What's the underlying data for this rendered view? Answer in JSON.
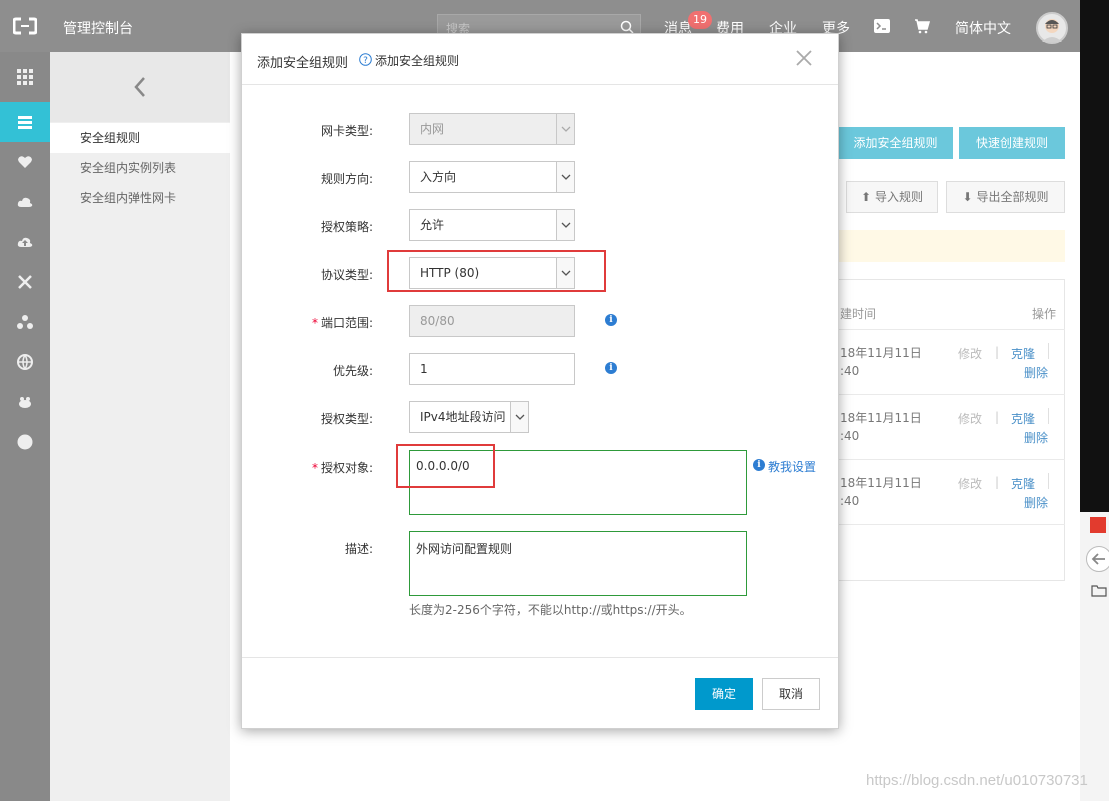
{
  "topbar": {
    "logo_icon": "aliyun-logo-icon",
    "title": "管理控制台",
    "search_placeholder": "搜索",
    "nav": {
      "messages": "消息",
      "messages_badge": "19",
      "fees": "费用",
      "enterprise": "企业",
      "more": "更多",
      "language": "简体中文"
    }
  },
  "subnav": {
    "items": [
      {
        "label": "安全组规则",
        "active": true
      },
      {
        "label": "安全组内实例列表",
        "active": false
      },
      {
        "label": "安全组内弹性网卡",
        "active": false
      }
    ]
  },
  "background_page": {
    "add_rule_button": "添加安全组规则",
    "quick_create_button": "快速创建规则",
    "import_button": "导入规则",
    "export_button": "导出全部规则",
    "col_time": "建时间",
    "col_action": "操作",
    "rows": [
      {
        "date": "18年11月11日",
        "time": ":40",
        "edit": "修改",
        "clone": "克隆",
        "delete": "删除"
      },
      {
        "date": "18年11月11日",
        "time": ":40",
        "edit": "修改",
        "clone": "克隆",
        "delete": "删除"
      },
      {
        "date": "18年11月11日",
        "time": ":40",
        "edit": "修改",
        "clone": "克隆",
        "delete": "删除"
      }
    ]
  },
  "dialog": {
    "title": "添加安全组规则",
    "subtitle": "添加安全组规则",
    "fields": {
      "nic_type": {
        "label": "网卡类型:",
        "value": "内网"
      },
      "direction": {
        "label": "规则方向:",
        "value": "入方向"
      },
      "policy": {
        "label": "授权策略:",
        "value": "允许"
      },
      "protocol": {
        "label": "协议类型:",
        "value": "HTTP (80)"
      },
      "port_range": {
        "label": "端口范围:",
        "value": "80/80"
      },
      "priority": {
        "label": "优先级:",
        "value": "1"
      },
      "auth_type": {
        "label": "授权类型:",
        "value": "IPv4地址段访问"
      },
      "auth_object": {
        "label": "授权对象:",
        "value": "0.0.0.0/0"
      },
      "description": {
        "label": "描述:",
        "value": "外网访问配置规则"
      }
    },
    "teach_link": "教我设置",
    "description_hint": "长度为2-256个字符，不能以http://或https://开头。",
    "ok_button": "确定",
    "cancel_button": "取消",
    "colors": {
      "primary": "#0099cc",
      "highlight": "#e03b3b",
      "valid_border": "#2e9a3a"
    }
  },
  "watermark": "https://blog.csdn.net/u010730731"
}
